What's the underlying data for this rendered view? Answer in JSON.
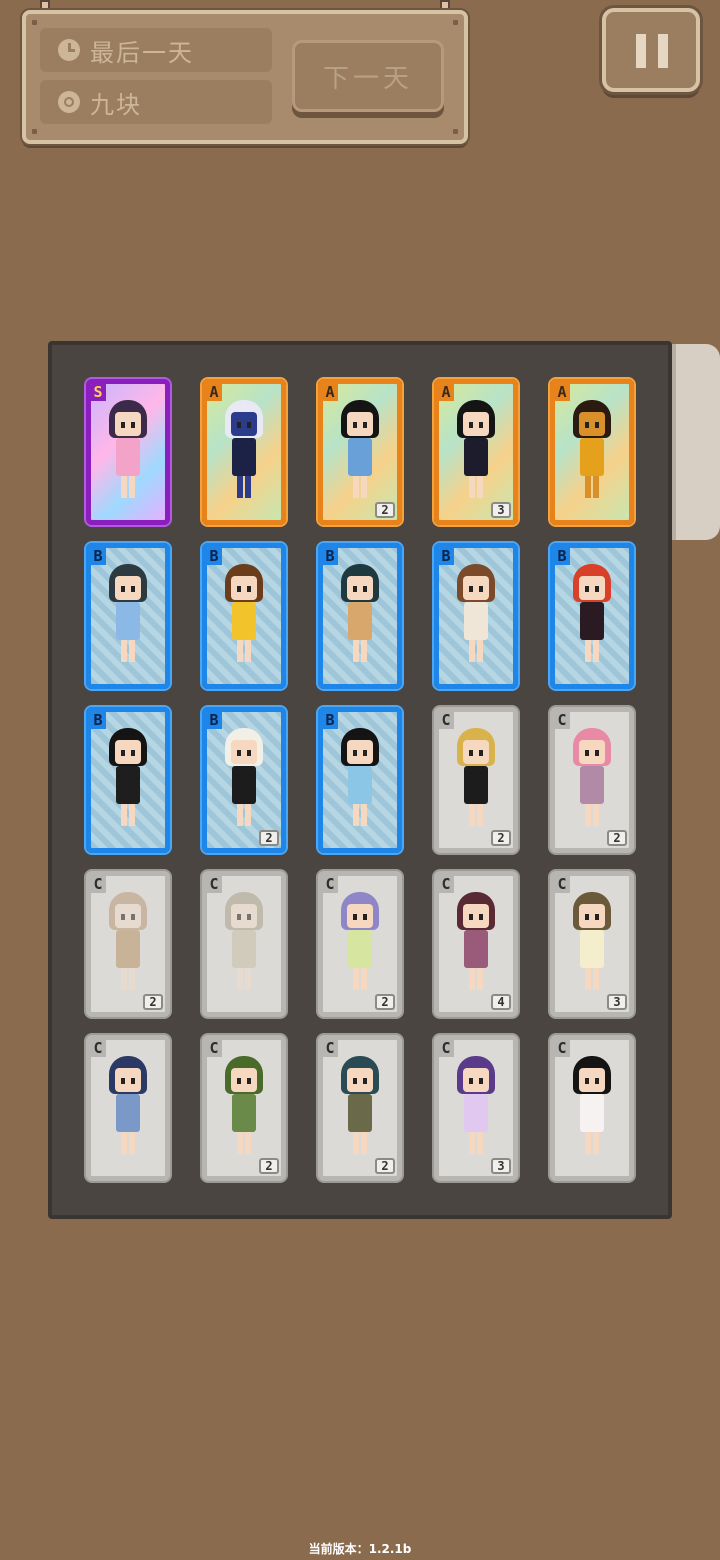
{
  "status": {
    "day_label": "最后一天",
    "money_label": "九块",
    "next_day_button": "下一天"
  },
  "colors": {
    "background": "#8b6b4e",
    "board": "#4a4541",
    "grade_S": "#8a1fbd",
    "grade_A": "#e8821b",
    "grade_B": "#1e86e8",
    "grade_C": "#b8b6b3"
  },
  "icons": {
    "day": "clock-icon",
    "money": "coin-icon",
    "pause": "pause-icon"
  },
  "cards": [
    {
      "grade": "S",
      "count": "",
      "hair": "#3b2a4a",
      "outfit": "#f4a3c8",
      "skin": "#f6d7bf"
    },
    {
      "grade": "A",
      "count": "",
      "hair": "#e9e9f6",
      "outfit": "#1b2246",
      "skin": "#2c3c8c"
    },
    {
      "grade": "A",
      "count": "2",
      "hair": "#141414",
      "outfit": "#6aa0d8",
      "skin": "#f6d7bf"
    },
    {
      "grade": "A",
      "count": "3",
      "hair": "#141414",
      "outfit": "#1c1c2c",
      "skin": "#f6d7bf"
    },
    {
      "grade": "A",
      "count": "",
      "hair": "#2a1a10",
      "outfit": "#e6a11c",
      "skin": "#d9902a"
    },
    {
      "grade": "B",
      "count": "",
      "hair": "#2d3b40",
      "outfit": "#8cb8e6",
      "skin": "#f6d7bf"
    },
    {
      "grade": "B",
      "count": "",
      "hair": "#6b3d1c",
      "outfit": "#f2c32a",
      "skin": "#f6d7bf"
    },
    {
      "grade": "B",
      "count": "",
      "hair": "#1e3a40",
      "outfit": "#d8a76b",
      "skin": "#f6d7bf"
    },
    {
      "grade": "B",
      "count": "",
      "hair": "#7a4a2a",
      "outfit": "#f0e6d8",
      "skin": "#f6d7bf"
    },
    {
      "grade": "B",
      "count": "",
      "hair": "#d8402a",
      "outfit": "#2a1a22",
      "skin": "#f6d7bf"
    },
    {
      "grade": "B",
      "count": "",
      "hair": "#141414",
      "outfit": "#1e1e1e",
      "skin": "#f6d7bf"
    },
    {
      "grade": "B",
      "count": "2",
      "hair": "#f2efe6",
      "outfit": "#1c1c1c",
      "skin": "#f6d7bf"
    },
    {
      "grade": "B",
      "count": "",
      "hair": "#141414",
      "outfit": "#8cc6e6",
      "skin": "#f6d7bf"
    },
    {
      "grade": "C",
      "count": "2",
      "hair": "#d8b24a",
      "outfit": "#1c1c1c",
      "skin": "#f6d7bf"
    },
    {
      "grade": "C",
      "count": "2",
      "hair": "#e88aa6",
      "outfit": "#b08aa6",
      "skin": "#f6d7bf"
    },
    {
      "grade": "C",
      "count": "2",
      "hair": "#b89a78",
      "outfit": "#b89468",
      "skin": "#f0dccb",
      "muted": true
    },
    {
      "grade": "C",
      "count": "",
      "hair": "#a8a08a",
      "outfit": "#c8bfa4",
      "skin": "#f0dccb",
      "muted": true
    },
    {
      "grade": "C",
      "count": "2",
      "hair": "#8f86c8",
      "outfit": "#d6e6a0",
      "skin": "#f6d7bf"
    },
    {
      "grade": "C",
      "count": "4",
      "hair": "#5a2a34",
      "outfit": "#9a5a7a",
      "skin": "#f6d7bf"
    },
    {
      "grade": "C",
      "count": "3",
      "hair": "#6a5a3a",
      "outfit": "#f4eecc",
      "skin": "#f6d7bf"
    },
    {
      "grade": "C",
      "count": "",
      "hair": "#2a3a64",
      "outfit": "#7a98c8",
      "skin": "#f6d7bf"
    },
    {
      "grade": "C",
      "count": "2",
      "hair": "#4a6a2a",
      "outfit": "#6a8a4a",
      "skin": "#f6d7bf"
    },
    {
      "grade": "C",
      "count": "2",
      "hair": "#2a4a54",
      "outfit": "#6a6a4a",
      "skin": "#f6d7bf"
    },
    {
      "grade": "C",
      "count": "3",
      "hair": "#5a3a8a",
      "outfit": "#e0c8f0",
      "skin": "#f6d7bf"
    },
    {
      "grade": "C",
      "count": "",
      "hair": "#141414",
      "outfit": "#f6f2f2",
      "skin": "#f6d7bf"
    }
  ],
  "footer": {
    "version": "当前版本：1.2.1b"
  }
}
